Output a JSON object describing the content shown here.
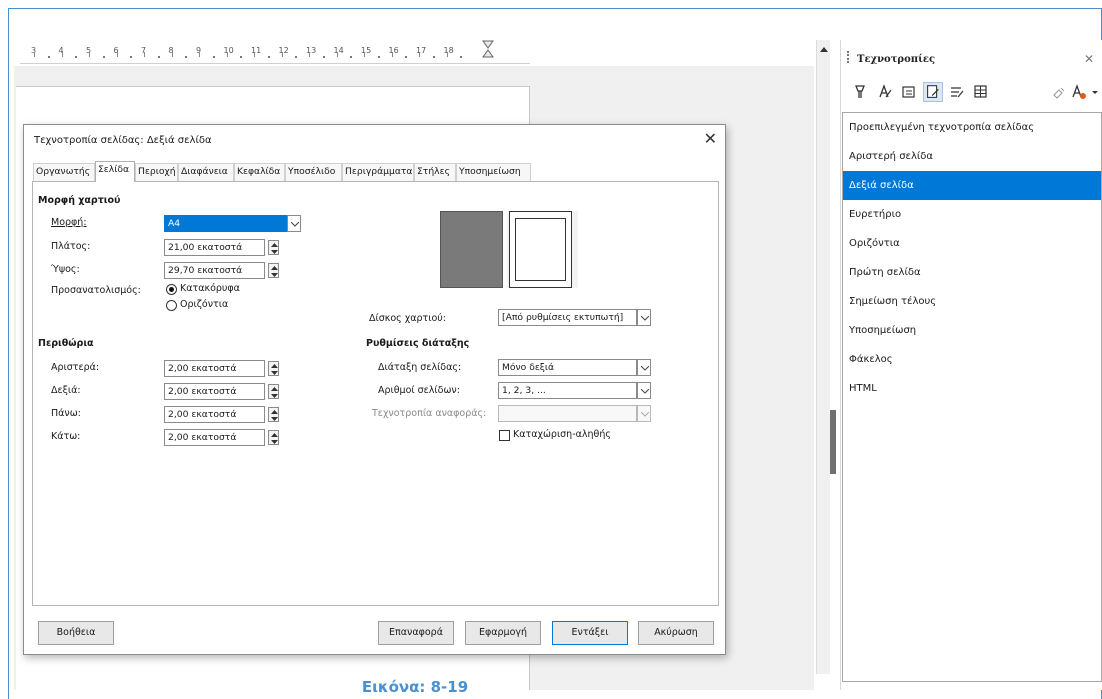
{
  "ruler": {
    "numbers": [
      "3",
      "4",
      "5",
      "6",
      "7",
      "8",
      "9",
      "10",
      "11",
      "12",
      "13",
      "14",
      "15",
      "16",
      "17",
      "18"
    ]
  },
  "sidebar": {
    "title": "Τεχνοτροπίες",
    "styles": [
      "Προεπιλεγμένη τεχνοτροπία σελίδας",
      "Αριστερή σελίδα",
      "Δεξιά σελίδα",
      "Ευρετήριο",
      "Οριζόντια",
      "Πρώτη σελίδα",
      "Σημείωση τέλους",
      "Υποσημείωση",
      "Φάκελος",
      "HTML"
    ],
    "selected_style": "Δεξιά σελίδα"
  },
  "dialog": {
    "title": "Τεχνοτροπία σελίδας: Δεξιά σελίδα",
    "tabs": [
      "Οργανωτής",
      "Σελίδα",
      "Περιοχή",
      "Διαφάνεια",
      "Κεφαλίδα",
      "Υποσέλιδο",
      "Περιγράμματα",
      "Στήλες",
      "Υποσημείωση"
    ],
    "active_tab": "Σελίδα",
    "paper_format": {
      "heading": "Μορφή χαρτιού",
      "format_label": "Μορφή:",
      "format_value": "A4",
      "width_label": "Πλάτος:",
      "width_value": "21,00 εκατοστά",
      "height_label": "Ύψος:",
      "height_value": "29,70 εκατοστά",
      "orientation_label": "Προσανατολισμός:",
      "portrait": "Κατακόρυφα",
      "landscape": "Οριζόντια",
      "tray_label": "Δίσκος χαρτιού:",
      "tray_value": "[Από ρυθμίσεις εκτυπωτή]"
    },
    "margins": {
      "heading": "Περιθώρια",
      "left_label": "Αριστερά:",
      "left_value": "2,00 εκατοστά",
      "right_label": "Δεξιά:",
      "right_value": "2,00 εκατοστά",
      "top_label": "Πάνω:",
      "top_value": "2,00 εκατοστά",
      "bottom_label": "Κάτω:",
      "bottom_value": "2,00 εκατοστά"
    },
    "layout": {
      "heading": "Ρυθμίσεις διάταξης",
      "page_layout_label": "Διάταξη σελίδας:",
      "page_layout_value": "Μόνο δεξιά",
      "page_numbers_label": "Αριθμοί σελίδων:",
      "page_numbers_value": "1, 2, 3, ...",
      "ref_style_label": "Τεχνοτροπία αναφοράς:",
      "ref_style_value": "",
      "register_true_label": "Καταχώριση-αληθής"
    },
    "buttons": {
      "help": "Βοήθεια",
      "reset": "Επαναφορά",
      "apply": "Εφαρμογή",
      "ok": "Εντάξει",
      "cancel": "Ακύρωση"
    }
  },
  "caption": "Εικόνα: 8-19",
  "colors": {
    "accent": "#0078d7",
    "frame": "#4a90d0",
    "caption": "#4a90d0"
  }
}
